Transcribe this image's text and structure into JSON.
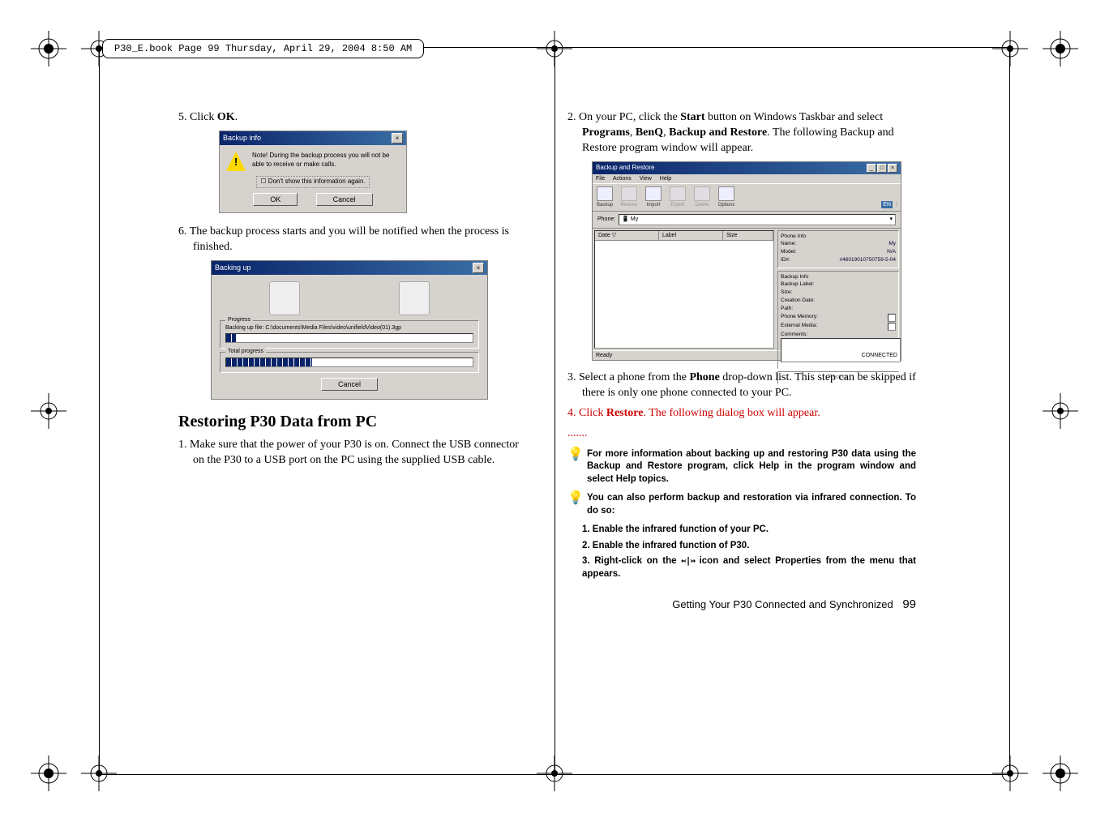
{
  "header": "P30_E.book  Page 99  Thursday, April 29, 2004  8:50 AM",
  "left": {
    "step5": "5. Click ",
    "step5b": "OK",
    "step5c": ".",
    "dlg1": {
      "title": "Backup info",
      "note": "Note! During the backup process you will not be able to receive or make calls.",
      "checkbox": "Don't show this information again.",
      "ok": "OK",
      "cancel": "Cancel"
    },
    "step6": "6. The backup process starts and you will be notified when the process is finished.",
    "dlg2": {
      "title": "Backing up",
      "progress_legend": "Progress",
      "progress_text": "Backing up file: C:\\documents\\Media Files\\video\\unifieldVideo(01).3gp",
      "total_legend": "Total progress",
      "cancel": "Cancel"
    },
    "heading": "Restoring P30 Data from PC",
    "r1": "1. Make sure that the power of your P30 is on. Connect the USB connector on the P30 to a USB port on the PC using the supplied USB cable."
  },
  "right": {
    "r2a": "2. On your PC, click the ",
    "r2b": "Start",
    "r2c": " button on Windows Taskbar and select ",
    "r2d": "Programs",
    "r2e": ", ",
    "r2f": "BenQ",
    "r2g": ", ",
    "r2h": "Backup and Restore",
    "r2i": ". The following Backup and Restore program window will appear.",
    "win": {
      "title": "Backup and Restore",
      "menu": [
        "File",
        "Actions",
        "View",
        "Help"
      ],
      "toolbar": [
        "Backup",
        "Restore",
        "Import",
        "Export",
        "Delete",
        "Options"
      ],
      "lang": "EN",
      "phone_label": "Phone:",
      "phone_value": "My",
      "cols": [
        "Date ▽",
        "Label",
        "Size"
      ],
      "info_title": "Phone Info",
      "rows": {
        "Name:": "My",
        "Model:": "N/A",
        "ID#:": "#46019010750759-5-04"
      },
      "bk_title": "Backup Info",
      "bk_rows": [
        "Backup Label:",
        "Size:",
        "Creation Date:",
        "Path:"
      ],
      "pm": "Phone Memory:",
      "em": "External Media:",
      "comments": "Comments:",
      "restore_caption": "Restore",
      "status_left": "Ready",
      "status_right": "CONNECTED"
    },
    "r3a": "3. Select a phone from the ",
    "r3b": "Phone",
    "r3c": " drop-down list. This step can be skipped if there is only one phone connected to your PC.",
    "r4a": "4. Click ",
    "r4b": "Restore",
    "r4c": ". The following dialog box will appear.",
    "dots": ".......",
    "tip1": "For more information about backing up and restoring P30 data using the Backup and Restore program, click Help in the program window and select Help topics.",
    "tip2": "You can also perform backup and restoration via infrared connection. To do so:",
    "n1": "1. Enable the infrared function of your PC.",
    "n2": "2. Enable the infrared function of P30.",
    "n3a": "3. Right-click on the ",
    "n3b": " icon and select Properties from the menu that appears.",
    "footer_text": "Getting Your P30 Connected and Synchronized",
    "footer_page": "99"
  }
}
